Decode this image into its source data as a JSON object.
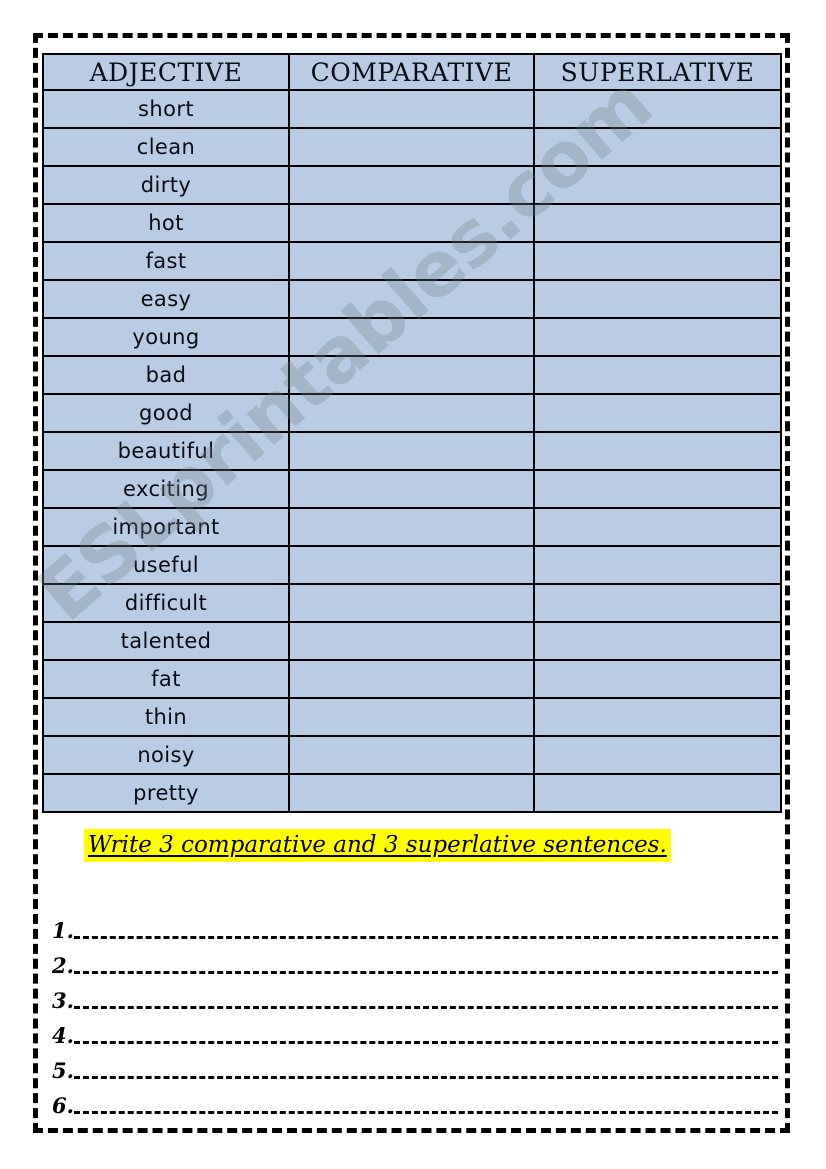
{
  "worksheet": {
    "table": {
      "headers": [
        "ADJECTIVE",
        "COMPARATIVE",
        "SUPERLATIVE"
      ],
      "rows": [
        {
          "adjective": "short",
          "comparative": "",
          "superlative": ""
        },
        {
          "adjective": "clean",
          "comparative": "",
          "superlative": ""
        },
        {
          "adjective": "dirty",
          "comparative": "",
          "superlative": ""
        },
        {
          "adjective": "hot",
          "comparative": "",
          "superlative": ""
        },
        {
          "adjective": "fast",
          "comparative": "",
          "superlative": ""
        },
        {
          "adjective": "easy",
          "comparative": "",
          "superlative": ""
        },
        {
          "adjective": "young",
          "comparative": "",
          "superlative": ""
        },
        {
          "adjective": "bad",
          "comparative": "",
          "superlative": ""
        },
        {
          "adjective": "good",
          "comparative": "",
          "superlative": ""
        },
        {
          "adjective": "beautiful",
          "comparative": "",
          "superlative": ""
        },
        {
          "adjective": "exciting",
          "comparative": "",
          "superlative": ""
        },
        {
          "adjective": "important",
          "comparative": "",
          "superlative": ""
        },
        {
          "adjective": "useful",
          "comparative": "",
          "superlative": ""
        },
        {
          "adjective": "difficult",
          "comparative": "",
          "superlative": ""
        },
        {
          "adjective": "talented",
          "comparative": "",
          "superlative": ""
        },
        {
          "adjective": "fat",
          "comparative": "",
          "superlative": ""
        },
        {
          "adjective": "thin",
          "comparative": "",
          "superlative": ""
        },
        {
          "adjective": "noisy",
          "comparative": "",
          "superlative": ""
        },
        {
          "adjective": "pretty",
          "comparative": "",
          "superlative": ""
        }
      ]
    },
    "instruction": "Write 3 comparative and 3 superlative sentences.",
    "answer_lines": [
      {
        "number": "1."
      },
      {
        "number": "2."
      },
      {
        "number": "3."
      },
      {
        "number": "4."
      },
      {
        "number": "5."
      },
      {
        "number": "6."
      }
    ],
    "watermark": "ESLprintables.com",
    "colors": {
      "cell_fill": "#b9cce3",
      "grid": "#000000",
      "highlight": "#ffff00",
      "page_background": "#ffffff",
      "watermark": "#78808c"
    }
  }
}
